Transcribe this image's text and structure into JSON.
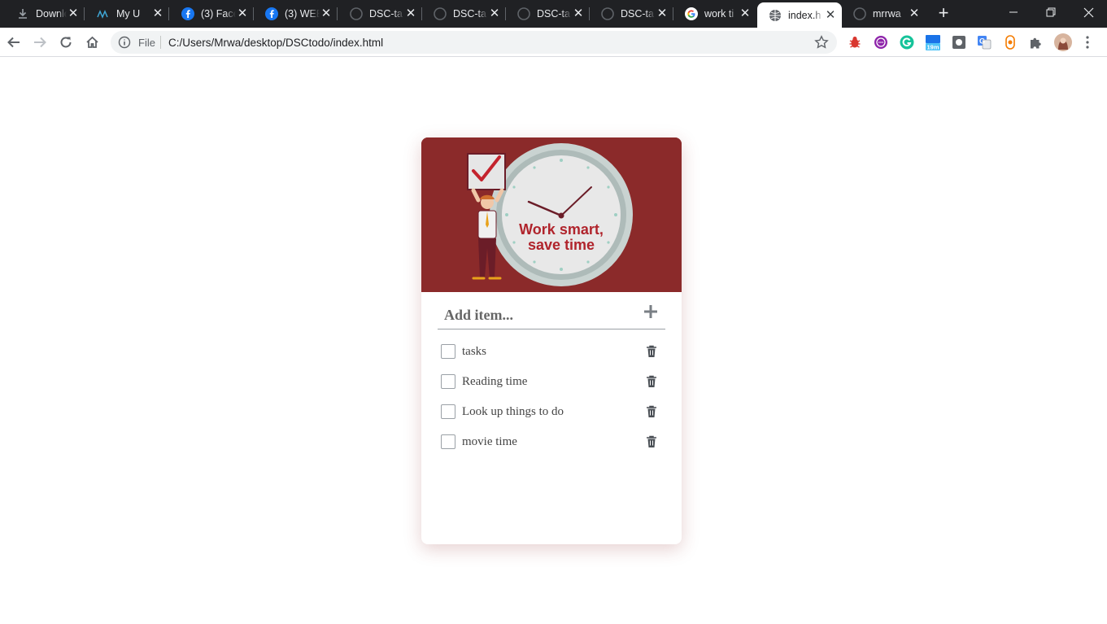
{
  "browser": {
    "tabs": [
      {
        "title": "Downlo",
        "icon": "download-icon"
      },
      {
        "title": "My U",
        "icon": "site-favicon"
      },
      {
        "title": "(3) Face",
        "icon": "facebook-icon"
      },
      {
        "title": "(3) WEB",
        "icon": "facebook-icon"
      },
      {
        "title": "DSC-ta",
        "icon": "github-icon"
      },
      {
        "title": "DSC-ta",
        "icon": "github-icon"
      },
      {
        "title": "DSC-ta",
        "icon": "github-icon"
      },
      {
        "title": "DSC-ta",
        "icon": "github-icon"
      },
      {
        "title": "work ti",
        "icon": "google-icon"
      },
      {
        "title": "index.h",
        "icon": "globe-icon",
        "active": true
      },
      {
        "title": "mrrwa",
        "icon": "github-icon"
      }
    ],
    "address": {
      "scheme_label": "File",
      "url": "C:/Users/Mrwa/desktop/DSCtodo/index.html"
    },
    "extension_badge": "19m",
    "colors": {
      "tabbar": "#202124",
      "omnibox": "#f1f3f4"
    }
  },
  "app": {
    "banner": {
      "line1": "Work smart,",
      "line2": "save time",
      "colors": {
        "background": "#8b2a2a",
        "text": "#b0242c",
        "clock_face": "#e8e8e8"
      }
    },
    "input": {
      "placeholder": "Add item..."
    },
    "add_icon": "plus-icon",
    "items": [
      {
        "label": "tasks",
        "checked": false
      },
      {
        "label": "Reading time",
        "checked": false
      },
      {
        "label": "Look up things to do",
        "checked": false
      },
      {
        "label": "movie time",
        "checked": false
      }
    ],
    "delete_icon": "trash-icon"
  }
}
